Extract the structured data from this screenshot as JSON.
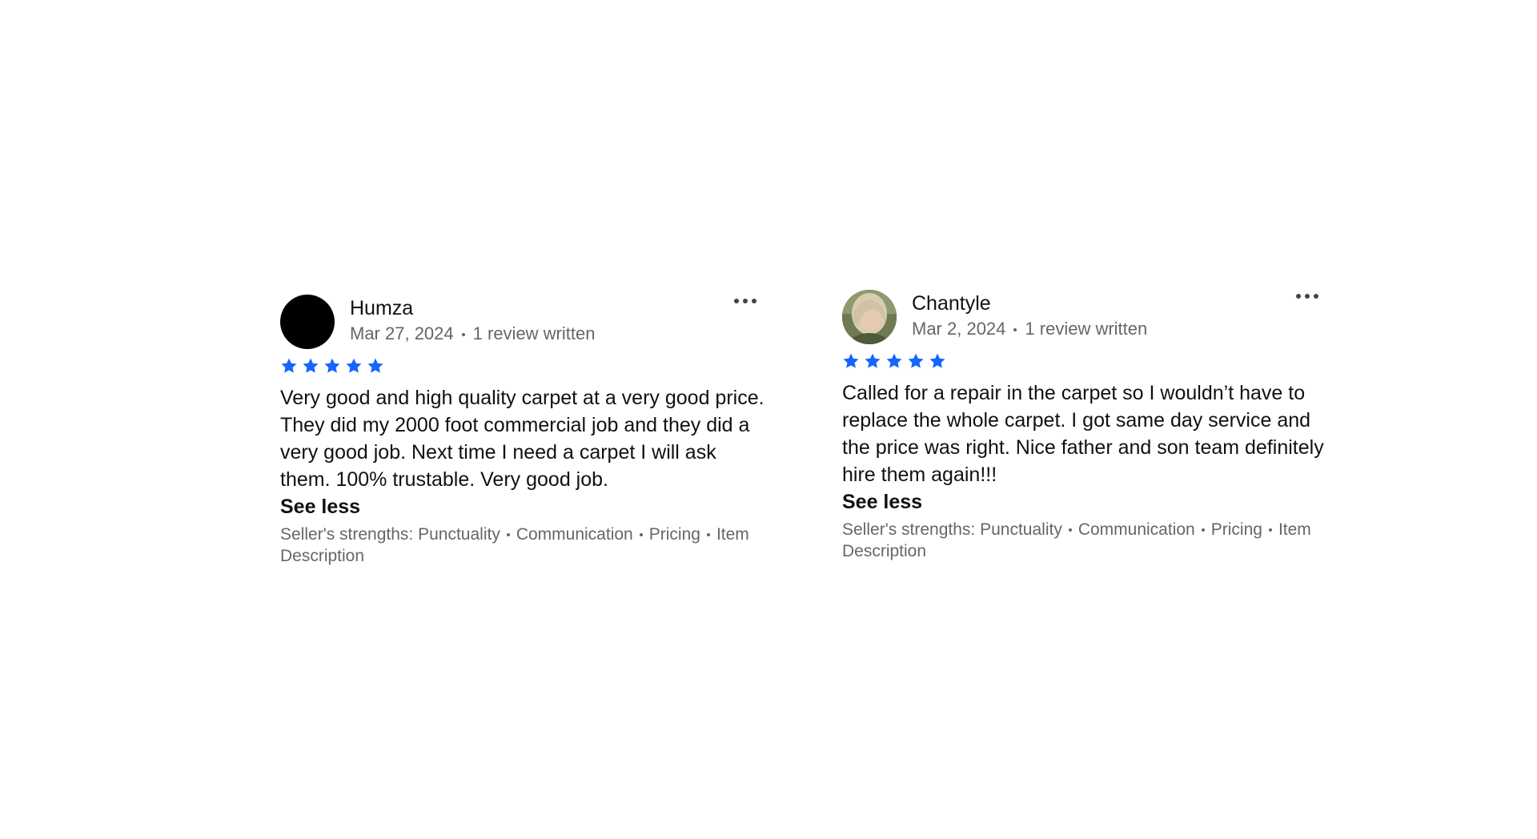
{
  "colors": {
    "star": "#1565ff",
    "text": "#111111",
    "muted": "#666666"
  },
  "reviews": [
    {
      "name": "Humza",
      "date": "Mar 27, 2024",
      "reviews_written": "1 review written",
      "rating": 5,
      "avatar": "black-circle-avatar",
      "text": "Very good and high quality carpet at a very good price. They did my 2000 foot commercial job and they did a very good job. Next time I need a carpet I will ask them. 100% trustable. Very good job.",
      "see_less_label": "See less",
      "strengths_label": "Seller's strengths:",
      "strengths": [
        "Punctuality",
        "Communication",
        "Pricing",
        "Item Description"
      ]
    },
    {
      "name": "Chantyle",
      "date": "Mar 2, 2024",
      "reviews_written": "1 review written",
      "rating": 5,
      "avatar": "profile-photo-avatar",
      "text": "Called for a repair in the carpet so I wouldn’t have to replace the whole carpet. I got same day service and the price was right. Nice father and son team definitely hire them again!!!",
      "see_less_label": "See less",
      "strengths_label": "Seller's strengths:",
      "strengths": [
        "Punctuality",
        "Communication",
        "Pricing",
        "Item Description"
      ]
    }
  ]
}
